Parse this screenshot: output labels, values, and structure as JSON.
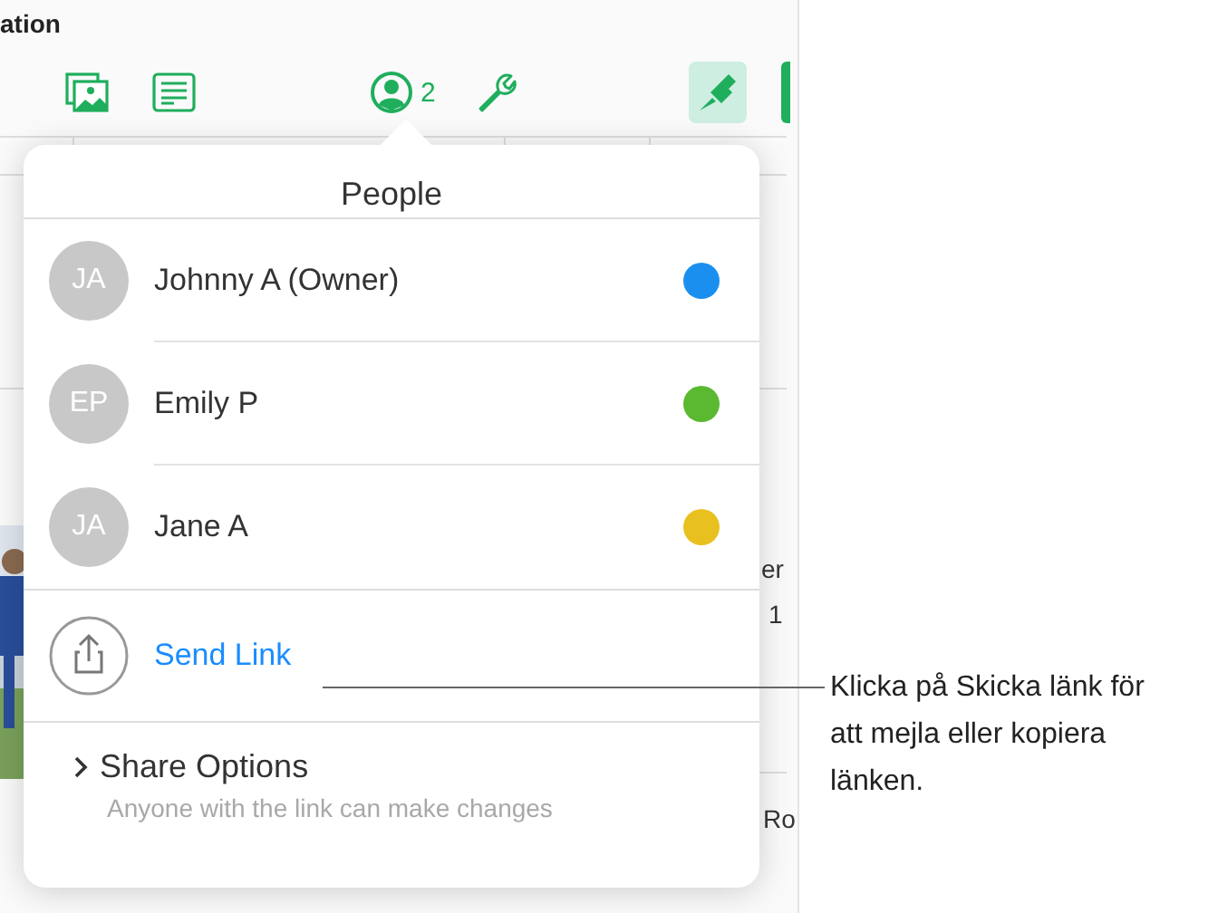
{
  "window": {
    "title": "ation"
  },
  "toolbar": {
    "tools": [
      {
        "kind": "media",
        "selected": false
      },
      {
        "kind": "text",
        "selected": false
      },
      {
        "kind": "collaborate",
        "selected": false,
        "count": "2"
      },
      {
        "kind": "wrench",
        "selected": false
      },
      {
        "kind": "brush",
        "selected": true
      },
      {
        "kind": "doc",
        "selected": false
      }
    ]
  },
  "background": {
    "fragments": [
      "er",
      "1",
      "Ro"
    ]
  },
  "popover": {
    "title": "People",
    "people": [
      {
        "initials": "JA",
        "name": "Johnny A (Owner)",
        "color": "#1a8ff0"
      },
      {
        "initials": "EP",
        "name": "Emily P",
        "color": "#5ab930"
      },
      {
        "initials": "JA",
        "name": "Jane A",
        "color": "#e8c020"
      }
    ],
    "send_link": "Send Link",
    "share_options": {
      "label": "Share Options",
      "description": "Anyone with the link can make changes"
    }
  },
  "callout": "Klicka på Skicka länk för att mejla eller kopiera länken."
}
